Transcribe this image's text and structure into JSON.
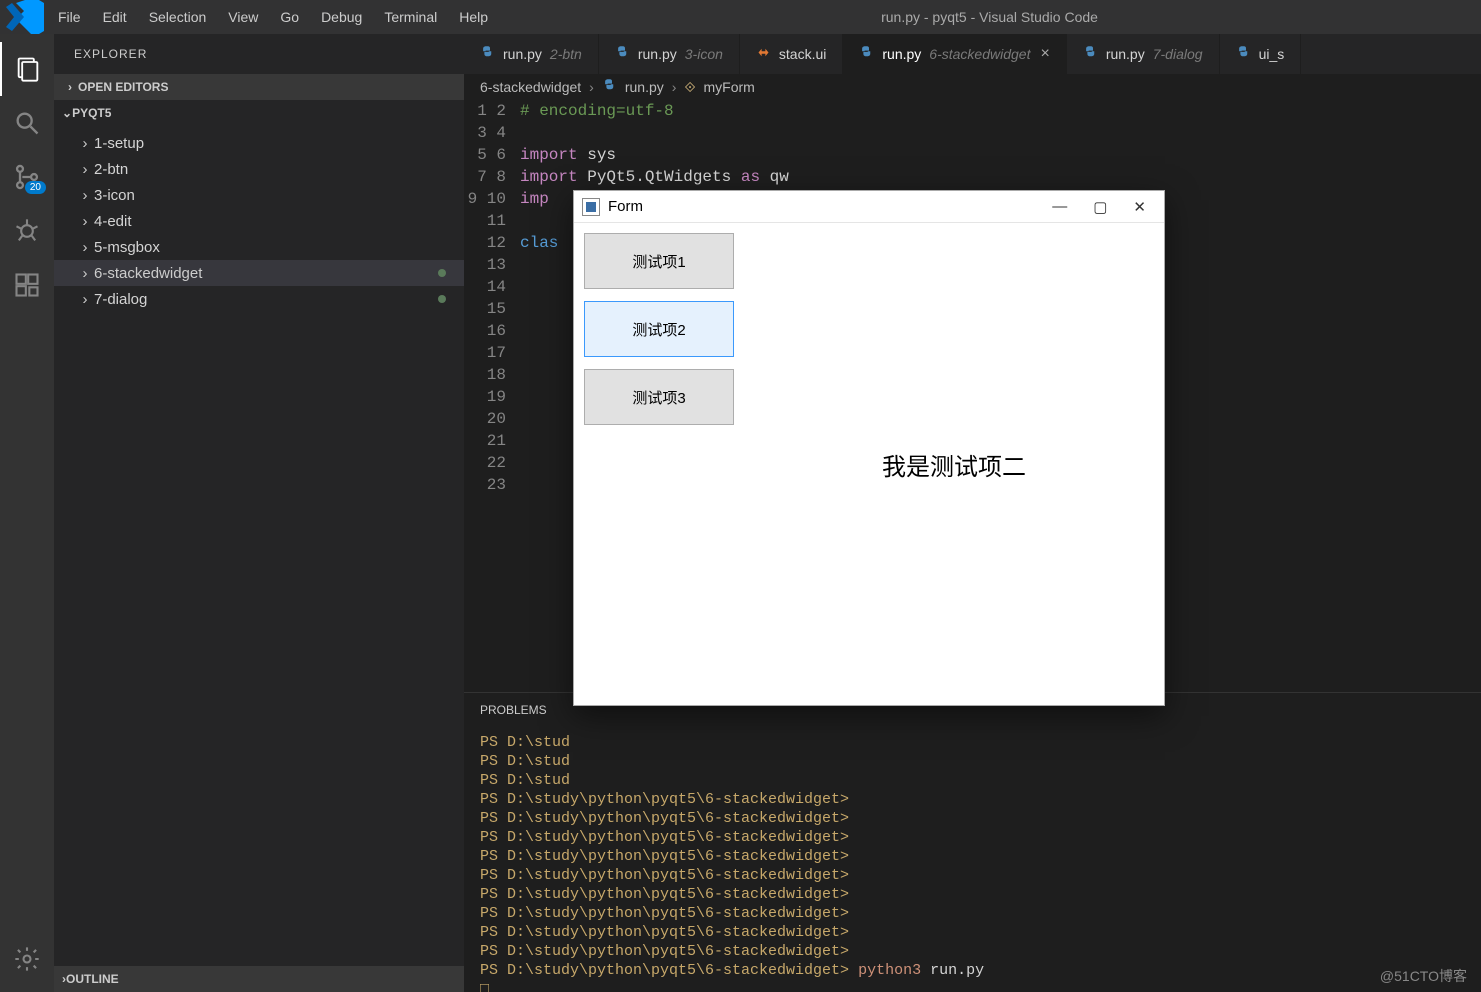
{
  "titlebar": {
    "menus": [
      "File",
      "Edit",
      "Selection",
      "View",
      "Go",
      "Debug",
      "Terminal",
      "Help"
    ],
    "title": "run.py - pyqt5 - Visual Studio Code"
  },
  "activity": {
    "scm_badge": "20"
  },
  "explorer": {
    "title": "EXPLORER",
    "open_editors": "OPEN EDITORS",
    "folder": "PYQT5",
    "items": [
      {
        "label": "1-setup",
        "dirty": false,
        "selected": false
      },
      {
        "label": "2-btn",
        "dirty": false,
        "selected": false
      },
      {
        "label": "3-icon",
        "dirty": false,
        "selected": false
      },
      {
        "label": "4-edit",
        "dirty": false,
        "selected": false
      },
      {
        "label": "5-msgbox",
        "dirty": false,
        "selected": false
      },
      {
        "label": "6-stackedwidget",
        "dirty": true,
        "selected": true
      },
      {
        "label": "7-dialog",
        "dirty": true,
        "selected": false
      }
    ],
    "outline": "OUTLINE"
  },
  "tabs": [
    {
      "icon": "python",
      "name": "run.py",
      "dim": "2-btn",
      "active": false
    },
    {
      "icon": "python",
      "name": "run.py",
      "dim": "3-icon",
      "active": false
    },
    {
      "icon": "xml",
      "name": "stack.ui",
      "dim": "",
      "active": false
    },
    {
      "icon": "python",
      "name": "run.py",
      "dim": "6-stackedwidget",
      "active": true,
      "close": true
    },
    {
      "icon": "python",
      "name": "run.py",
      "dim": "7-dialog",
      "active": false
    },
    {
      "icon": "python",
      "name": "ui_s",
      "dim": "",
      "active": false
    }
  ],
  "breadcrumbs": {
    "parts": [
      "6-stackedwidget",
      "run.py",
      "myForm"
    ]
  },
  "code": {
    "lines": 23,
    "l1": "# encoding=utf-8",
    "l3a": "import",
    "l3b": " sys",
    "l4a": "import",
    "l4b": " PyQt5.QtWidgets ",
    "l4c": "as",
    "l4d": " qw",
    "l5": "imp",
    "l7": "clas"
  },
  "panel": {
    "tab": "PROBLEMS",
    "lines": [
      "PS D:\\stud",
      "PS D:\\stud",
      "PS D:\\stud",
      "PS D:\\study\\python\\pyqt5\\6-stackedwidget>",
      "PS D:\\study\\python\\pyqt5\\6-stackedwidget>",
      "PS D:\\study\\python\\pyqt5\\6-stackedwidget>",
      "PS D:\\study\\python\\pyqt5\\6-stackedwidget>",
      "PS D:\\study\\python\\pyqt5\\6-stackedwidget>",
      "PS D:\\study\\python\\pyqt5\\6-stackedwidget>",
      "PS D:\\study\\python\\pyqt5\\6-stackedwidget>",
      "PS D:\\study\\python\\pyqt5\\6-stackedwidget>",
      "PS D:\\study\\python\\pyqt5\\6-stackedwidget>"
    ],
    "cmd_line_prompt": "PS D:\\study\\python\\pyqt5\\6-stackedwidget> ",
    "cmd": "python3",
    "cmd_arg": " run.py",
    "cursor": "□"
  },
  "form": {
    "title": "Form",
    "btn1": "测试项1",
    "btn2": "测试项2",
    "btn3": "测试项3",
    "content": "我是测试项二"
  },
  "watermark": "@51CTO博客"
}
